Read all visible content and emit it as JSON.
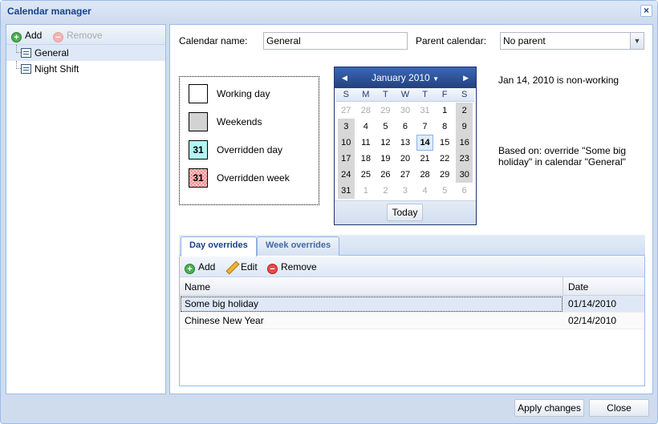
{
  "window": {
    "title": "Calendar manager"
  },
  "left_toolbar": {
    "add_label": "Add",
    "remove_label": "Remove"
  },
  "tree": {
    "items": [
      {
        "label": "General",
        "selected": true
      },
      {
        "label": "Night Shift",
        "selected": false
      }
    ]
  },
  "form": {
    "calendar_name_label": "Calendar name:",
    "calendar_name_value": "General",
    "parent_label": "Parent calendar:",
    "parent_value": "No parent"
  },
  "legend": {
    "working_day": "Working day",
    "weekends": "Weekends",
    "overridden_day": "Overridden day",
    "overridden_week": "Overridden week",
    "sample_day": "31"
  },
  "datepicker": {
    "month_label": "January 2010",
    "dow": [
      "S",
      "M",
      "T",
      "W",
      "T",
      "F",
      "S"
    ],
    "weeks": [
      [
        "27",
        "28",
        "29",
        "30",
        "31",
        "1",
        "2"
      ],
      [
        "3",
        "4",
        "5",
        "6",
        "7",
        "8",
        "9"
      ],
      [
        "10",
        "11",
        "12",
        "13",
        "14",
        "15",
        "16"
      ],
      [
        "17",
        "18",
        "19",
        "20",
        "21",
        "22",
        "23"
      ],
      [
        "24",
        "25",
        "26",
        "27",
        "28",
        "29",
        "30"
      ],
      [
        "31",
        "1",
        "2",
        "3",
        "4",
        "5",
        "6"
      ]
    ],
    "today_label": "Today"
  },
  "info": {
    "status": "Jan 14, 2010 is non-working",
    "based_on_line1": "Based on: override \"Some big",
    "based_on_line2": "holiday\" in calendar \"General\""
  },
  "tabs": {
    "day_overrides": "Day overrides",
    "week_overrides": "Week overrides"
  },
  "overrides_toolbar": {
    "add_label": "Add",
    "edit_label": "Edit",
    "remove_label": "Remove"
  },
  "overrides_grid": {
    "columns": {
      "name": "Name",
      "date": "Date"
    },
    "rows": [
      {
        "name": "Some big holiday",
        "date": "01/14/2010"
      },
      {
        "name": "Chinese New Year",
        "date": "02/14/2010"
      }
    ]
  },
  "footer": {
    "apply_label": "Apply changes",
    "close_label": "Close"
  },
  "colors": {
    "accent": "#15428b",
    "border": "#99bbe8",
    "weekend": "#d7d7d7",
    "overridden_day": "#b2f5f5"
  }
}
